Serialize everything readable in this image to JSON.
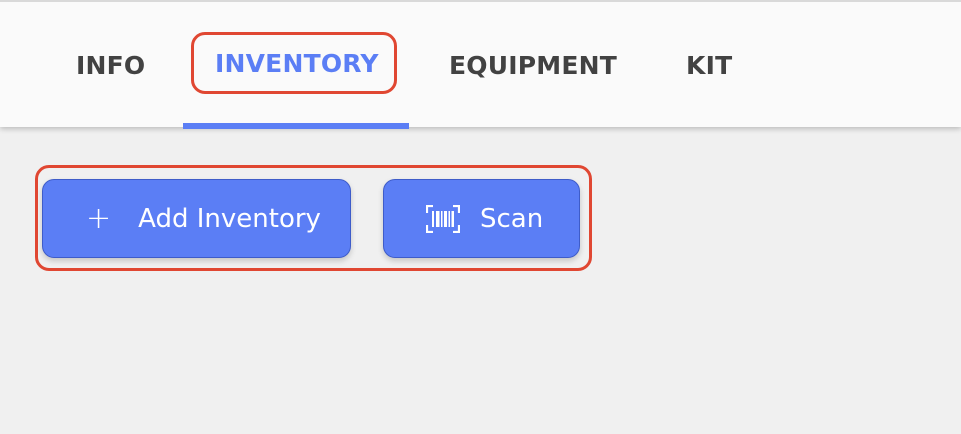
{
  "tabs": [
    {
      "label": "INFO",
      "active": false
    },
    {
      "label": "INVENTORY",
      "active": true
    },
    {
      "label": "EQUIPMENT",
      "active": false
    },
    {
      "label": "KIT",
      "active": false
    }
  ],
  "actions": {
    "add_label": "Add Inventory",
    "add_icon": "plus-icon",
    "scan_label": "Scan",
    "scan_icon": "barcode-scan-icon"
  },
  "colors": {
    "accent": "#5b7ef5",
    "highlight": "#e04732",
    "tab_text": "#424242",
    "background": "#f0f0f0"
  }
}
